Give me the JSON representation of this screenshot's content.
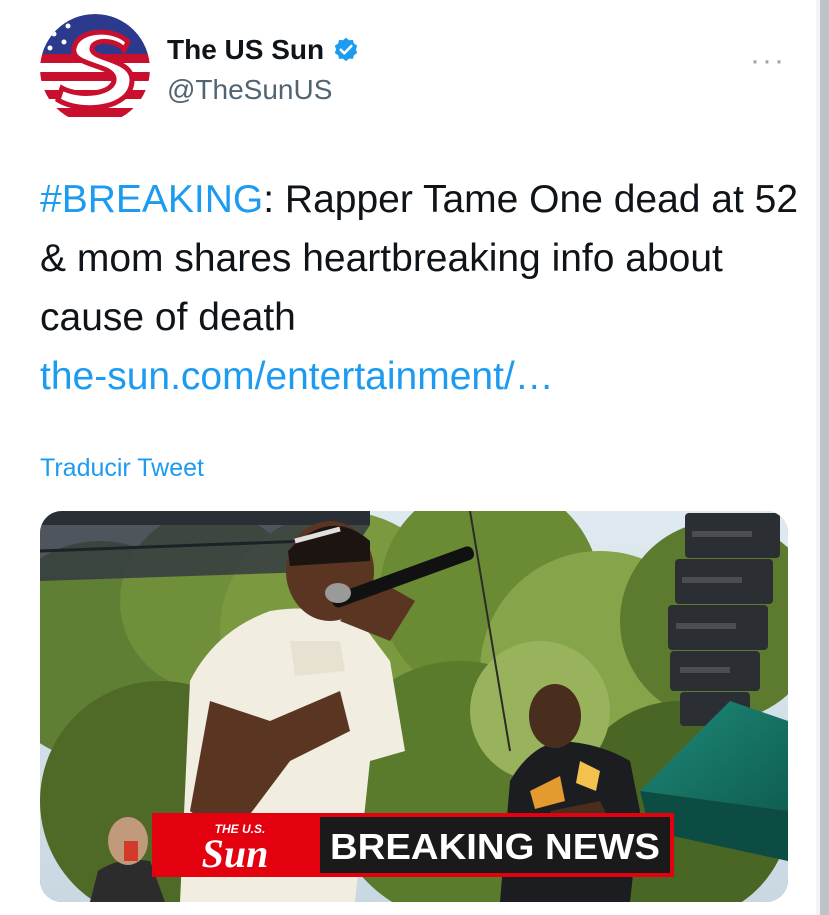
{
  "author": {
    "display_name": "The US Sun",
    "handle": "@TheSunUS",
    "verified": true,
    "avatar_icon": "us-sun-logo"
  },
  "tweet": {
    "hashtag": "#BREAKING",
    "text": ": Rapper Tame One dead at 52 & mom shares heartbreaking info about cause of death",
    "link": "the-sun.com/entertainment/…",
    "translate_label": "Traducir Tweet"
  },
  "media": {
    "banner_small": "THE U.S.",
    "banner_logo": "Sun",
    "banner_text": "BREAKING NEWS"
  },
  "menu": {
    "more_label": "···"
  },
  "colors": {
    "accent": "#1d9bf0",
    "text": "#0f1419",
    "secondary": "#536471",
    "banner_red": "#e3000f"
  }
}
